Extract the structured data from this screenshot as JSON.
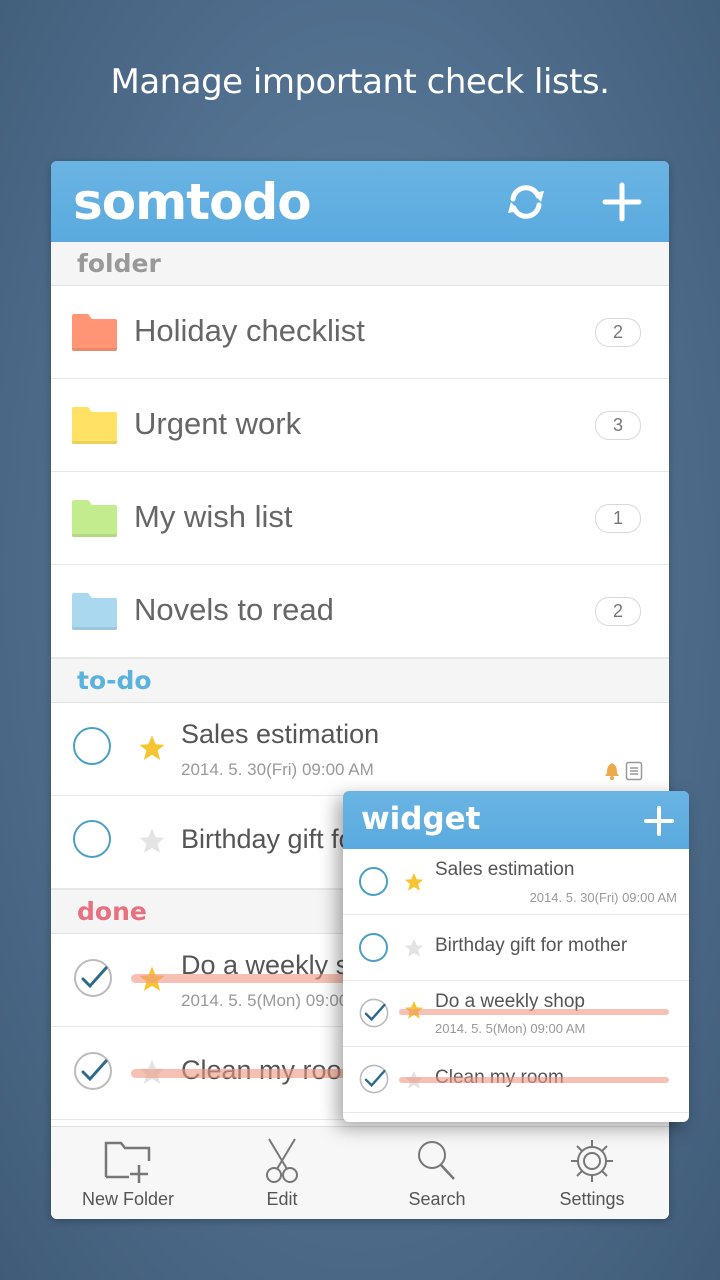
{
  "promo": {
    "title": "Manage important check lists."
  },
  "app": {
    "logo": "somtodo",
    "header_icons": {
      "sync": "sync-icon",
      "add": "plus-icon"
    },
    "colors": {
      "header": "#5aaadf",
      "todo_section": "#5ab2dd",
      "done_section": "#e8707f",
      "check": "#2d6a8a",
      "star_on": "#f7c531",
      "star_off": "#e0e0e0"
    }
  },
  "sections": {
    "folder": "folder",
    "todo": "to-do",
    "done": "done"
  },
  "folders": [
    {
      "name": "Holiday checklist",
      "count": "2",
      "color": "#ff9574"
    },
    {
      "name": "Urgent work",
      "count": "3",
      "color": "#ffe263"
    },
    {
      "name": "My wish list",
      "count": "1",
      "color": "#c2ec8e"
    },
    {
      "name": "Novels to read",
      "count": "2",
      "color": "#aad8ef"
    }
  ],
  "todos": [
    {
      "title": "Sales estimation",
      "date": "2014. 5. 30(Fri) 09:00 AM",
      "starred": true,
      "has_alarm": true,
      "has_memo": true
    },
    {
      "title": "Birthday gift for mother",
      "date": "",
      "starred": false
    }
  ],
  "done": [
    {
      "title": "Do a weekly shop",
      "date": "2014. 5. 5(Mon) 09:00 AM",
      "starred": true
    },
    {
      "title": "Clean my room",
      "date": "",
      "starred": false
    }
  ],
  "tabs": [
    {
      "label": "New Folder",
      "icon": "new-folder-icon"
    },
    {
      "label": "Edit",
      "icon": "scissors-icon"
    },
    {
      "label": "Search",
      "icon": "search-icon"
    },
    {
      "label": "Settings",
      "icon": "gear-icon"
    }
  ],
  "widget": {
    "title": "widget",
    "items": [
      {
        "title": "Sales estimation",
        "date": "2014. 5. 30(Fri) 09:00 AM",
        "starred": true,
        "done": false
      },
      {
        "title": "Birthday gift for mother",
        "date": "",
        "starred": false,
        "done": false
      },
      {
        "title": "Do a weekly shop",
        "date": "2014. 5. 5(Mon) 09:00 AM",
        "starred": true,
        "done": true
      },
      {
        "title": "Clean my room",
        "date": "",
        "starred": false,
        "done": true
      }
    ]
  }
}
